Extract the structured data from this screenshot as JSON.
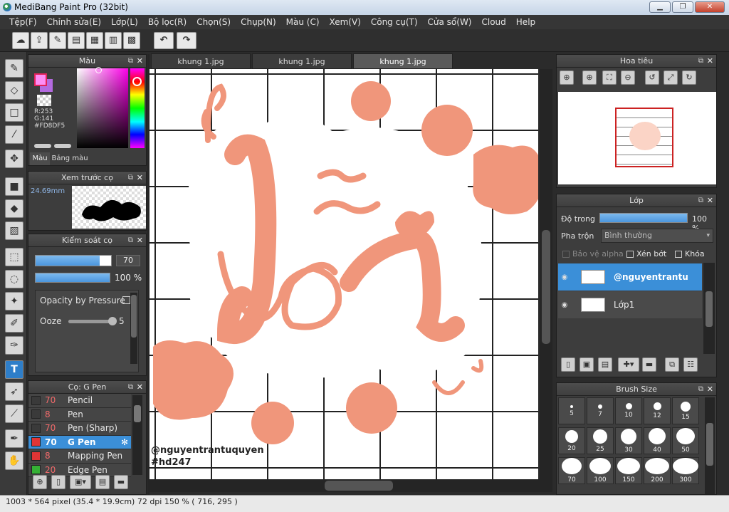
{
  "window": {
    "title": "MediBang Paint Pro (32bit)",
    "min": "▁",
    "max": "❐",
    "close": "✕"
  },
  "menu": [
    "Tệp(F)",
    "Chỉnh sửa(E)",
    "Lớp(L)",
    "Bộ lọc(R)",
    "Chọn(S)",
    "Chụp(N)",
    "Màu (C)",
    "Xem(V)",
    "Công cụ(T)",
    "Cửa sổ(W)",
    "Cloud",
    "Help"
  ],
  "toolbar_icons": [
    "cloud-icon",
    "share-icon",
    "comment-icon",
    "chat-icon",
    "layout-icon",
    "panel-icon",
    "grid-icon",
    "undo-icon",
    "redo-icon"
  ],
  "tools": [
    "brush-icon",
    "eraser-icon",
    "rectangle-icon",
    "dot-brush-icon",
    "move-icon",
    "fill-rect-icon",
    "bucket-icon",
    "gradient-icon",
    "select-rect-icon",
    "lasso-icon",
    "magic-wand-icon",
    "select-pen-icon",
    "select-eraser-icon",
    "text-icon",
    "operation-icon",
    "eyedropper-icon",
    "pen-icon",
    "hand-icon"
  ],
  "color_panel": {
    "title": "Màu",
    "r": "R:253",
    "g": "G:141",
    "hex": "#FD8DF5",
    "tab_color": "Màu",
    "tab_palette": "Bảng màu",
    "primary": "#fd8df5",
    "secondary": "#b46ae0"
  },
  "preview_panel": {
    "title": "Xem trước cọ",
    "size": "24.69mm"
  },
  "brush_control": {
    "title": "Kiểm soát cọ",
    "size": "70",
    "opacity": "100 %",
    "size_fill": 0.85,
    "opacity_fill": 1.0,
    "opacity_pressure": "Opacity by Pressure",
    "ooze_label": "Ooze",
    "ooze_value": "5",
    "ooze_fill": 1.0
  },
  "brush_panel": {
    "title": "Cọ: G Pen",
    "items": [
      {
        "num": "70",
        "name": "Pencil",
        "color": "#3a3a3a"
      },
      {
        "num": "8",
        "name": "Pen",
        "color": "#3a3a3a"
      },
      {
        "num": "70",
        "name": "Pen (Sharp)",
        "color": "#3a3a3a"
      },
      {
        "num": "70",
        "name": "G Pen",
        "color": "#e03535"
      },
      {
        "num": "8",
        "name": "Mapping Pen",
        "color": "#e03535"
      },
      {
        "num": "20",
        "name": "Edge Pen",
        "color": "#35b035"
      }
    ]
  },
  "doc_tabs": [
    "khung 1.jpg",
    "khung 1.jpg",
    "khung 1.jpg"
  ],
  "canvas": {
    "text1": "lỗi",
    "watermark1": "@nguyentrantuquyen",
    "watermark2": "#hd247",
    "accent": "#f0967b"
  },
  "navigator": {
    "title": "Hoa tiêu"
  },
  "layer_panel": {
    "title": "Lớp",
    "opacity_label": "Độ trong",
    "opacity_value": "100 %",
    "opacity_fill": 1.0,
    "blend_label": "Pha trộn",
    "blend_value": "Bình thường",
    "protect_alpha": "Bảo vệ alpha",
    "clip": "Xén bớt",
    "lock": "Khóa",
    "layers": [
      {
        "name": "@nguyentrantu"
      },
      {
        "name": "Lớp1"
      }
    ]
  },
  "brush_size": {
    "title": "Brush Size",
    "sizes": [
      "5",
      "7",
      "10",
      "12",
      "15",
      "20",
      "25",
      "30",
      "40",
      "50",
      "70",
      "100",
      "150",
      "200",
      "300"
    ]
  },
  "status": "1003 * 564 pixel  (35.4 * 19.9cm)  72 dpi  150 %  ( 716, 295 )"
}
